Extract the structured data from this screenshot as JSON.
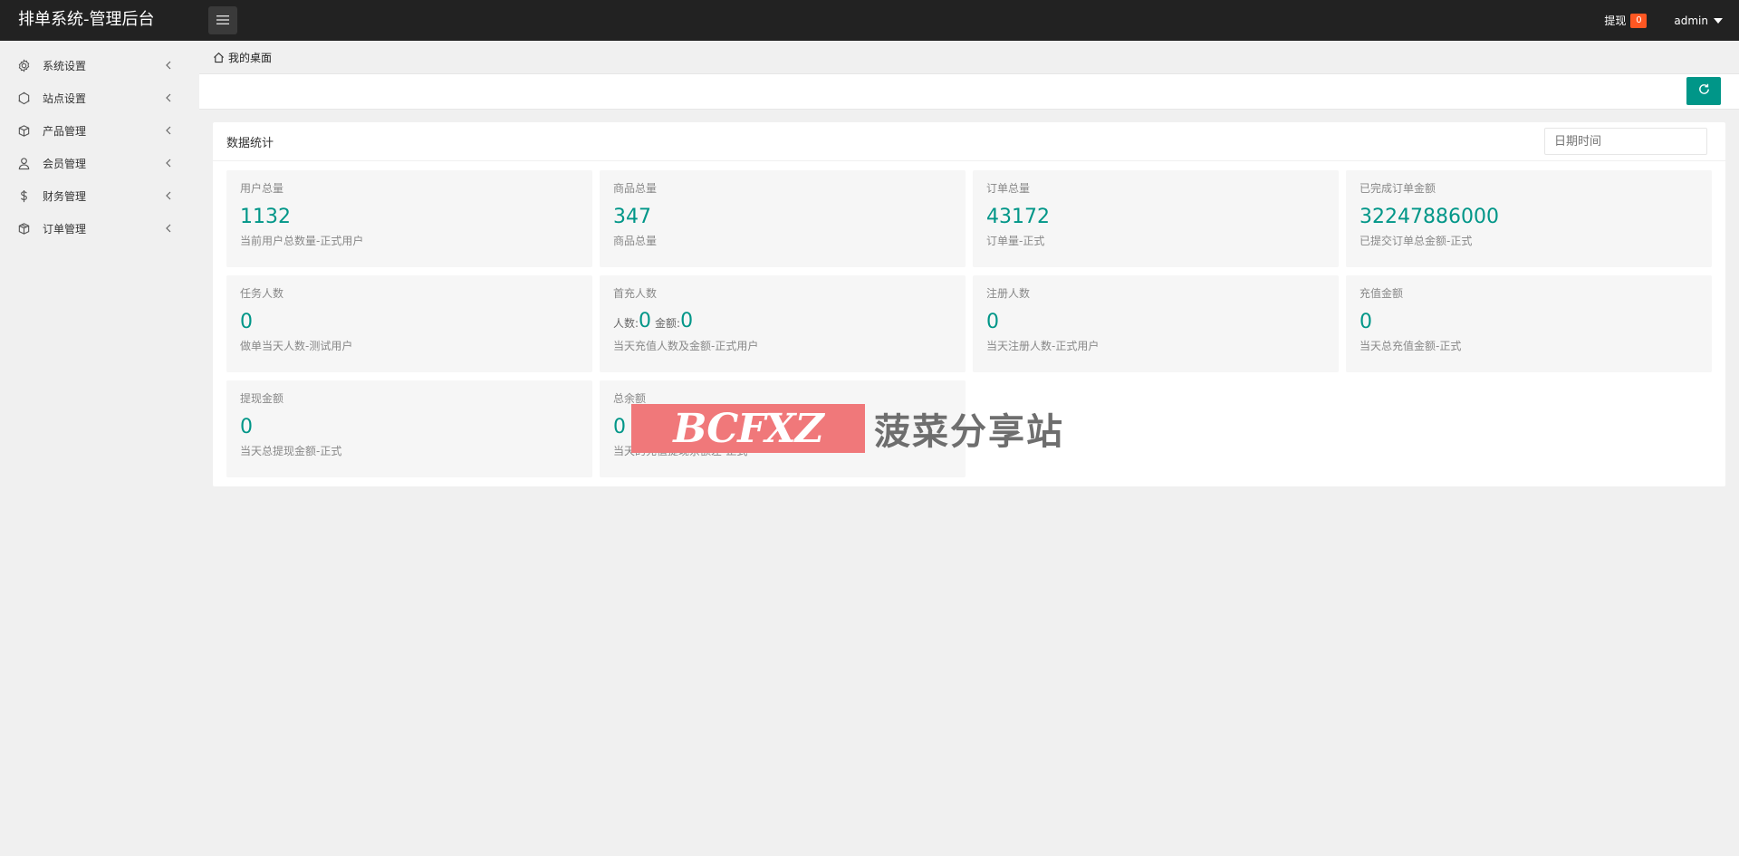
{
  "app": {
    "title": "排单系统-管理后台"
  },
  "header": {
    "withdraw_label": "提现",
    "withdraw_count": "0",
    "user_name": "admin"
  },
  "sidebar": {
    "items": [
      {
        "label": "系统设置",
        "icon": "gear-icon"
      },
      {
        "label": "站点设置",
        "icon": "site-icon"
      },
      {
        "label": "产品管理",
        "icon": "box-icon"
      },
      {
        "label": "会员管理",
        "icon": "user-icon"
      },
      {
        "label": "财务管理",
        "icon": "dollar-icon"
      },
      {
        "label": "订单管理",
        "icon": "order-box-icon"
      }
    ]
  },
  "breadcrumb": {
    "label": "我的桌面"
  },
  "stats": {
    "title": "数据统计",
    "date_placeholder": "日期时间",
    "cards": [
      {
        "title": "用户总量",
        "value": "1132",
        "desc": "当前用户总数量-正式用户"
      },
      {
        "title": "商品总量",
        "value": "347",
        "desc": "商品总量"
      },
      {
        "title": "订单总量",
        "value": "43172",
        "desc": "订单量-正式"
      },
      {
        "title": "已完成订单金额",
        "value": "32247886000",
        "desc": "已提交订单总金额-正式"
      },
      {
        "title": "任务人数",
        "value": "0",
        "desc": "做单当天人数-测试用户"
      },
      {
        "title": "首充人数",
        "people_label": "人数:",
        "people_value": "0",
        "amount_label": "金额:",
        "amount_value": "0",
        "desc": "当天充值人数及金额-正式用户"
      },
      {
        "title": "注册人数",
        "value": "0",
        "desc": "当天注册人数-正式用户"
      },
      {
        "title": "充值金额",
        "value": "0",
        "desc": "当天总充值金额-正式"
      },
      {
        "title": "提现金额",
        "value": "0",
        "desc": "当天总提现金额-正式"
      },
      {
        "title": "总余额",
        "value": "0",
        "desc": "当天的充值提现余额差-正式"
      }
    ]
  },
  "watermark": {
    "latin": "BCFXZ",
    "chinese": "菠菜分享站"
  },
  "colors": {
    "accent": "#009688",
    "header_bg": "#222222",
    "badge": "#ff5722",
    "watermark_red": "#f0787a"
  }
}
